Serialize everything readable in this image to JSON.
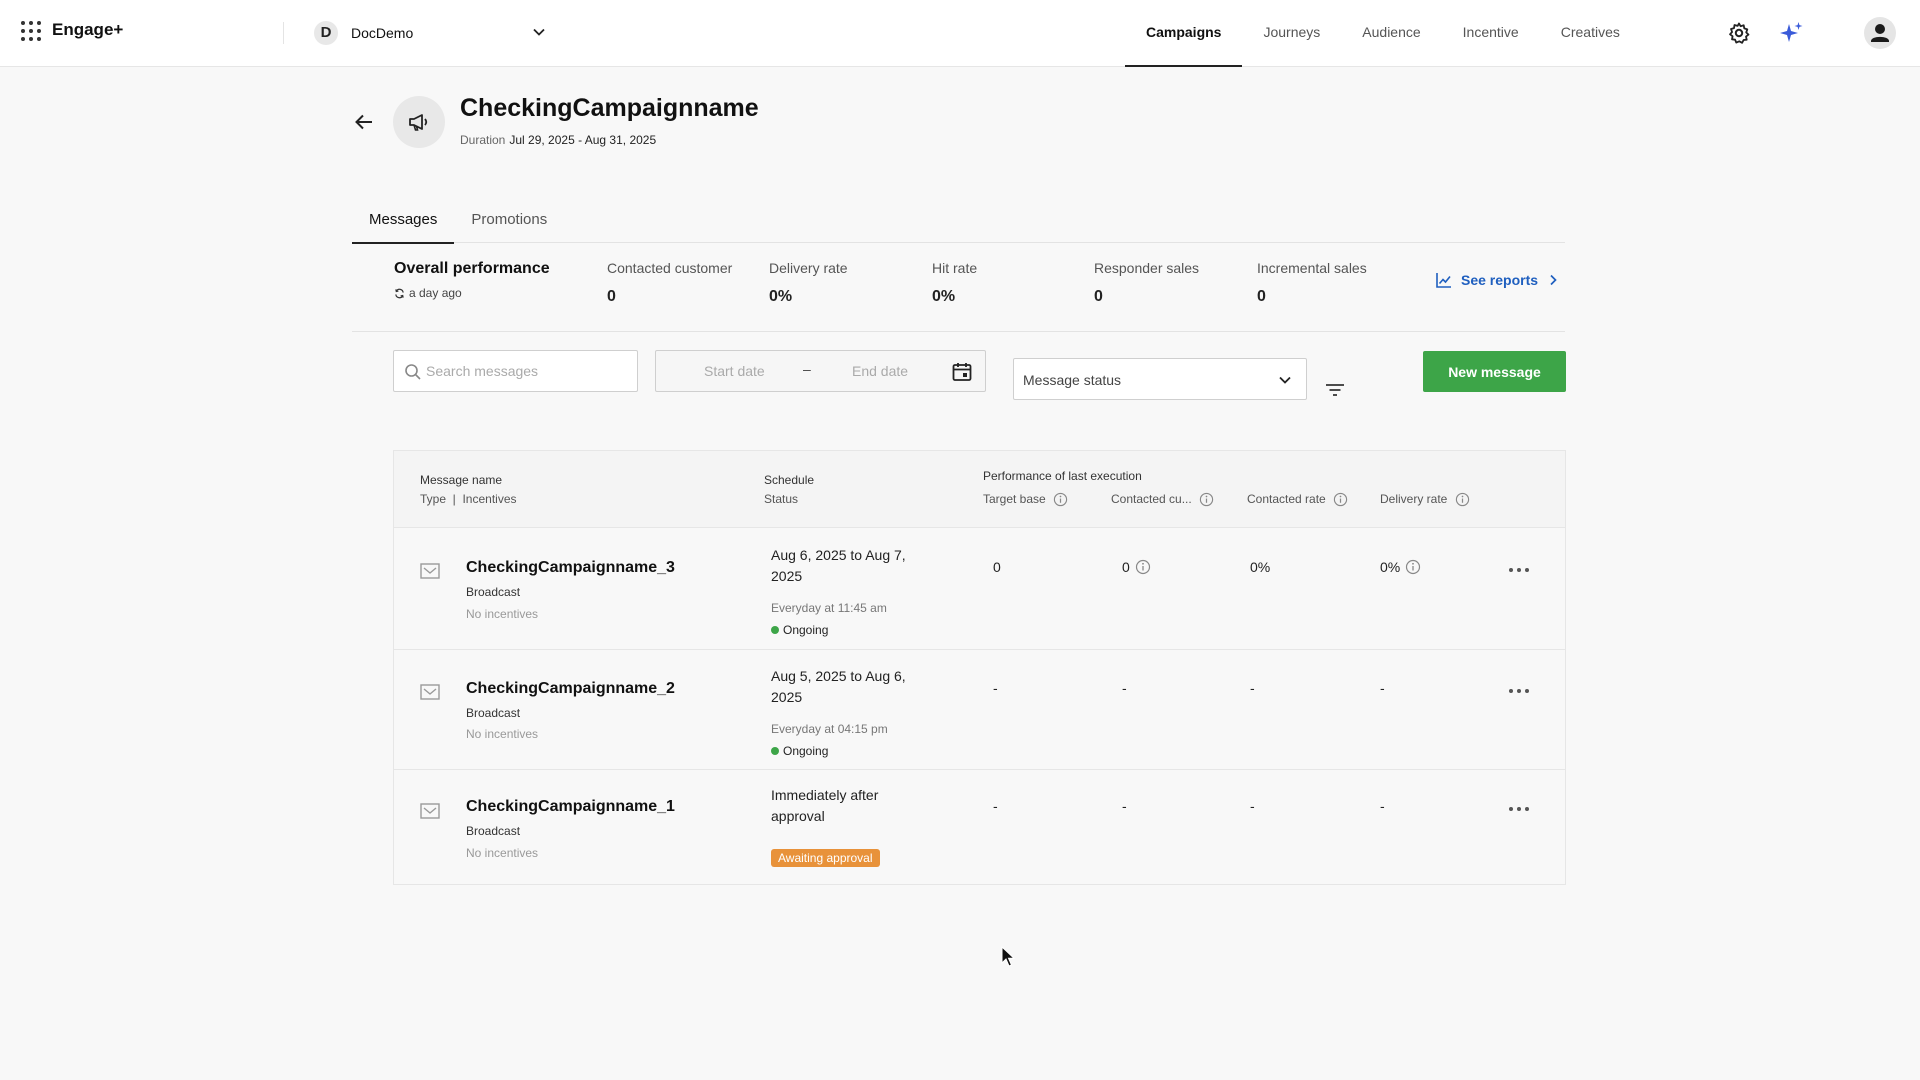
{
  "app": {
    "brand": "Engage+"
  },
  "workspace": {
    "initial": "D",
    "name": "DocDemo"
  },
  "nav": {
    "items": [
      {
        "label": "Campaigns",
        "active": true
      },
      {
        "label": "Journeys",
        "active": false
      },
      {
        "label": "Audience",
        "active": false
      },
      {
        "label": "Incentive",
        "active": false
      },
      {
        "label": "Creatives",
        "active": false
      }
    ]
  },
  "icons": {
    "settings": "gear-icon",
    "ai": "sparkle-icon",
    "profile": "user-icon",
    "apps": "grid-icon"
  },
  "campaign": {
    "title": "CheckingCampaignname",
    "duration_label": "Duration",
    "duration_value": "Jul 29, 2025 - Aug 31, 2025"
  },
  "tabs": [
    {
      "label": "Messages",
      "active": true
    },
    {
      "label": "Promotions",
      "active": false
    }
  ],
  "performance": {
    "title": "Overall performance",
    "updated": "a day ago",
    "metrics": [
      {
        "label": "Contacted customer",
        "value": "0"
      },
      {
        "label": "Delivery rate",
        "value": "0%"
      },
      {
        "label": "Hit rate",
        "value": "0%"
      },
      {
        "label": "Responder sales",
        "value": "0"
      },
      {
        "label": "Incremental sales",
        "value": "0"
      }
    ],
    "see_reports": "See reports"
  },
  "filters": {
    "search_placeholder": "Search messages",
    "start_date": "Start date",
    "date_separator": "–",
    "end_date": "End date",
    "status_placeholder": "Message status",
    "new_message": "New message"
  },
  "table": {
    "headers": {
      "name": "Message name",
      "type_incentives": "Type  |  Incentives",
      "schedule": "Schedule",
      "status": "Status",
      "perf_group": "Performance of last execution",
      "target_base": "Target base",
      "contacted_cu": "Contacted cu...",
      "contacted_rate": "Contacted rate",
      "delivery_rate": "Delivery rate"
    },
    "rows": [
      {
        "name": "CheckingCampaignname_3",
        "type": "Broadcast",
        "incentives": "No incentives",
        "schedule": "Aug 6, 2025 to Aug 7, 2025",
        "schedule_time": "Everyday at 11:45 am",
        "status": "Ongoing",
        "target_base": "0",
        "contacted": "0",
        "contacted_rate": "0%",
        "delivery_rate": "0%"
      },
      {
        "name": "CheckingCampaignname_2",
        "type": "Broadcast",
        "incentives": "No incentives",
        "schedule": "Aug 5, 2025 to Aug 6, 2025",
        "schedule_time": "Everyday at 04:15 pm",
        "status": "Ongoing",
        "target_base": "-",
        "contacted": "-",
        "contacted_rate": "-",
        "delivery_rate": "-"
      },
      {
        "name": "CheckingCampaignname_1",
        "type": "Broadcast",
        "incentives": "No incentives",
        "schedule": "Immediately after approval",
        "status": "Awaiting approval",
        "target_base": "-",
        "contacted": "-",
        "contacted_rate": "-",
        "delivery_rate": "-"
      }
    ]
  },
  "colors": {
    "primary_green": "#3da548",
    "link_blue": "#1f5fbf",
    "awaiting_orange": "#e8923a",
    "ai_blue": "#3a5bd9"
  }
}
